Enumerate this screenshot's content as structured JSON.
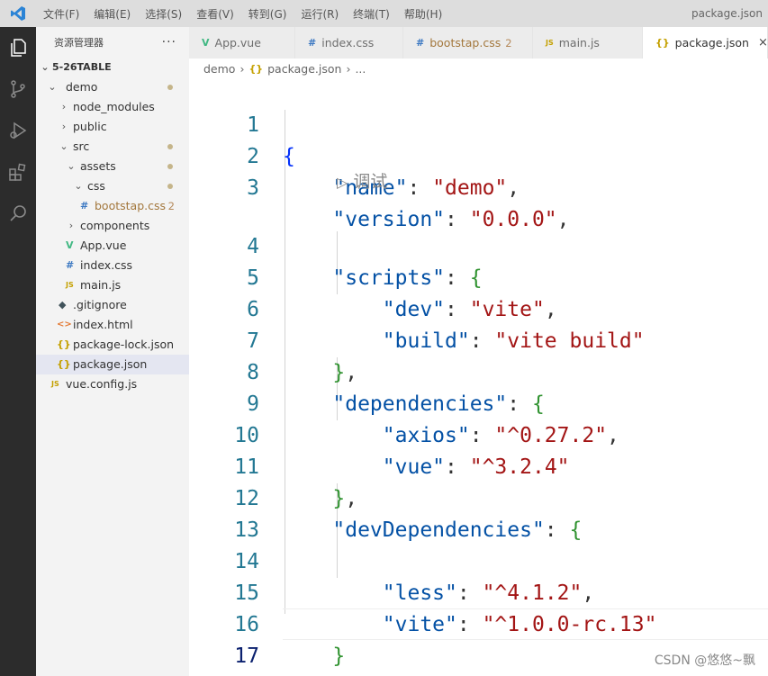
{
  "menubar": {
    "items": [
      "文件(F)",
      "编辑(E)",
      "选择(S)",
      "查看(V)",
      "转到(G)",
      "运行(R)",
      "终端(T)",
      "帮助(H)"
    ],
    "window_title": "package.json"
  },
  "sidebar": {
    "title": "资源管理器",
    "more": "···",
    "tree": [
      {
        "label": "5-26TABLE"
      },
      {
        "label": "demo"
      },
      {
        "label": "node_modules"
      },
      {
        "label": "public"
      },
      {
        "label": "src"
      },
      {
        "label": "assets"
      },
      {
        "label": "css"
      },
      {
        "label": "bootstap.css",
        "badge": "2",
        "icon": "#"
      },
      {
        "label": "components"
      },
      {
        "label": "App.vue",
        "icon": "V"
      },
      {
        "label": "index.css",
        "icon": "#"
      },
      {
        "label": "main.js",
        "icon": "JS"
      },
      {
        "label": ".gitignore",
        "icon": "◆"
      },
      {
        "label": "index.html",
        "icon": "<>"
      },
      {
        "label": "package-lock.json",
        "icon": "{}"
      },
      {
        "label": "package.json",
        "icon": "{}"
      },
      {
        "label": "vue.config.js",
        "icon": "JS"
      }
    ]
  },
  "tabs": [
    {
      "label": "App.vue",
      "icon": "V"
    },
    {
      "label": "index.css",
      "icon": "#"
    },
    {
      "label": "bootstap.css",
      "icon": "#",
      "badge": "2"
    },
    {
      "label": "main.js",
      "icon": "JS"
    },
    {
      "label": "package.json",
      "icon": "{}",
      "close": "×"
    }
  ],
  "breadcrumb": {
    "folder": "demo",
    "sep": "›",
    "file": "package.json",
    "icon": "{}",
    "tail": "..."
  },
  "editor": {
    "codelens": "调试",
    "line_numbers": [
      "1",
      "2",
      "3",
      "4",
      "5",
      "6",
      "7",
      "8",
      "9",
      "10",
      "11",
      "12",
      "13",
      "14",
      "15",
      "16",
      "17"
    ],
    "lines": {
      "l2_key": "\"name\"",
      "l2_val": "\"demo\"",
      "l3_key": "\"version\"",
      "l3_val": "\"0.0.0\"",
      "l4_key": "\"scripts\"",
      "l5_key": "\"dev\"",
      "l5_val": "\"vite\"",
      "l6_key": "\"build\"",
      "l6_val": "\"vite build\"",
      "l8_key": "\"dependencies\"",
      "l9_key": "\"axios\"",
      "l9_val": "\"^0.27.2\"",
      "l10_key": "\"vue\"",
      "l10_val": "\"^3.2.4\"",
      "l12_key": "\"devDependencies\"",
      "l14_key": "\"less\"",
      "l14_val": "\"^4.1.2\"",
      "l15_key": "\"vite\"",
      "l15_val": "\"^1.0.0-rc.13\""
    }
  },
  "watermark": "CSDN @悠悠~飘",
  "colors": {
    "keyword": "#0451a5",
    "string": "#a31515",
    "bracket_level1": "#0431fa",
    "bracket_level2": "#319331",
    "line_number": "#237893"
  }
}
